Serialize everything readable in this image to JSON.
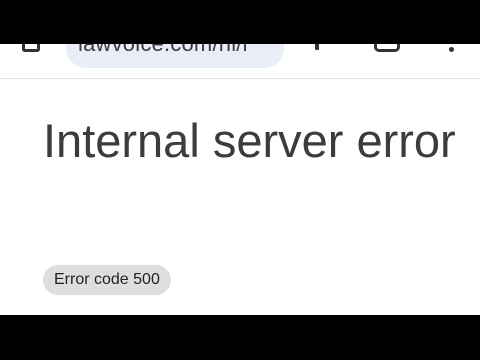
{
  "browser": {
    "url": "lawvoice.com/hi/i",
    "icons": {
      "home": "home-icon",
      "new_tab": "plus-icon",
      "tabs": "tabs-icon",
      "menu": "more-vert-icon"
    }
  },
  "page": {
    "title": "Internal server error",
    "error_code": "Error code 500"
  }
}
